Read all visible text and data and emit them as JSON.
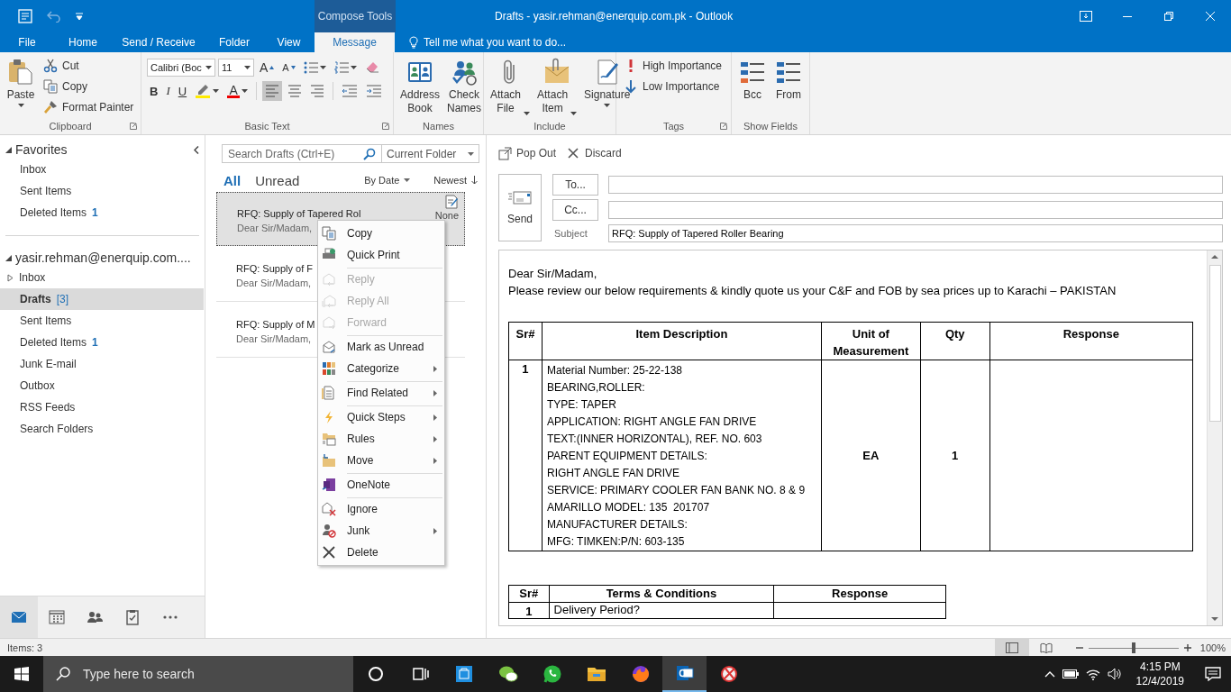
{
  "window": {
    "title": "Drafts - yasir.rehman@enerquip.com.pk - Outlook",
    "context_group": "Compose Tools"
  },
  "ribbon_tabs": [
    {
      "label": "File",
      "selected": false
    },
    {
      "label": "Home",
      "selected": false
    },
    {
      "label": "Send / Receive",
      "selected": false
    },
    {
      "label": "Folder",
      "selected": false
    },
    {
      "label": "View",
      "selected": false
    },
    {
      "label": "Message",
      "selected": true
    }
  ],
  "tell_me": {
    "placeholder": "Tell me what you want to do..."
  },
  "ribbon_groups": [
    {
      "label": "Clipboard",
      "kind": "buttons",
      "launcher": true,
      "buttons": [
        {
          "label": "Paste",
          "kind": "dropdown"
        },
        {
          "label": "Cut",
          "kind": "small"
        },
        {
          "label": "Copy",
          "kind": "small"
        },
        {
          "label": "Format Painter",
          "kind": "small"
        }
      ]
    },
    {
      "label": "Basic Text",
      "kind": "font",
      "launcher": true,
      "font": "Calibri (Boc",
      "size": "11",
      "size_buttons": [
        {
          "label": "A",
          "kind": "grow"
        },
        {
          "label": "A",
          "kind": "shrink"
        }
      ],
      "style_buttons": [
        "B",
        "I",
        "U"
      ],
      "font_color": "A",
      "align": [
        {
          "selected": true
        },
        {
          "selected": false
        },
        {
          "selected": false
        }
      ]
    },
    {
      "label": "Names",
      "kind": "buttons",
      "buttons": [
        {
          "label": "Address Book",
          "kind": "large"
        },
        {
          "label": "Check Names",
          "kind": "large"
        }
      ]
    },
    {
      "label": "Include",
      "kind": "buttons",
      "buttons": [
        {
          "label": "Attach File",
          "kind": "labelmenu"
        },
        {
          "label": "Attach Item",
          "kind": "labelmenu"
        },
        {
          "label": "Signature",
          "kind": "dropdown"
        }
      ]
    },
    {
      "label": "Tags",
      "kind": "buttons",
      "launcher": true,
      "buttons": [
        {
          "label": "High Importance",
          "kind": "small"
        },
        {
          "label": "Low Importance",
          "kind": "small"
        }
      ]
    },
    {
      "label": "Show Fields",
      "kind": "buttons",
      "buttons": [
        {
          "label": "Bcc",
          "kind": "large"
        },
        {
          "label": "From",
          "kind": "large"
        }
      ]
    }
  ],
  "navigation": {
    "sections": [
      {
        "header": "Favorites",
        "expanded": true,
        "folders": [
          {
            "name": "Inbox",
            "kind": "plain",
            "selected": false
          },
          {
            "name": "Sent Items",
            "kind": "plain",
            "selected": false
          },
          {
            "name": "Deleted Items",
            "kind": "plain",
            "count": "1",
            "selected": false
          }
        ]
      },
      {
        "header": "yasir.rehman@enerquip.com....",
        "expanded": true,
        "folders": [
          {
            "name": "Inbox",
            "kind": "expandable",
            "expanded": false,
            "selected": false
          },
          {
            "name": "Drafts",
            "kind": "plain",
            "count": "[3]",
            "selected": true
          },
          {
            "name": "Sent Items",
            "kind": "plain",
            "selected": false
          },
          {
            "name": "Deleted Items",
            "kind": "plain",
            "count": "1",
            "selected": false
          },
          {
            "name": "Junk E-mail",
            "kind": "plain",
            "selected": false
          },
          {
            "name": "Outbox",
            "kind": "plain",
            "selected": false
          },
          {
            "name": "RSS Feeds",
            "kind": "plain",
            "selected": false
          },
          {
            "name": "Search Folders",
            "kind": "plain",
            "selected": false
          }
        ]
      }
    ],
    "modules": [
      {
        "selected": true
      },
      {
        "selected": false
      },
      {
        "selected": false
      },
      {
        "selected": false
      },
      {
        "selected": false
      }
    ]
  },
  "message_list": {
    "search": {
      "placeholder": "Search Drafts (Ctrl+E)"
    },
    "scope": "Current Folder",
    "filters": [
      {
        "label": "All",
        "selected": true
      },
      {
        "label": "Unread",
        "selected": false
      }
    ],
    "sort": "By Date",
    "order": "Newest",
    "messages": [
      {
        "subject": "RFQ: Supply of Tapered Rol",
        "preview": "Dear Sir/Madam,",
        "category": "None",
        "selected": true
      },
      {
        "subject": "RFQ: Supply of F",
        "preview": "Dear Sir/Madam,",
        "selected": false
      },
      {
        "subject": "RFQ: Supply of M",
        "preview": "Dear Sir/Madam,",
        "selected": false
      }
    ]
  },
  "context_menu": [
    {
      "label": "Copy",
      "disabled": false,
      "submenu": false,
      "separator_after": false
    },
    {
      "label": "Quick Print",
      "disabled": false,
      "submenu": false,
      "separator_after": true
    },
    {
      "label": "Reply",
      "disabled": true,
      "submenu": false,
      "separator_after": false
    },
    {
      "label": "Reply All",
      "disabled": true,
      "submenu": false,
      "separator_after": false
    },
    {
      "label": "Forward",
      "disabled": true,
      "submenu": false,
      "separator_after": true
    },
    {
      "label": "Mark as Unread",
      "disabled": false,
      "submenu": false,
      "separator_after": false
    },
    {
      "label": "Categorize",
      "disabled": false,
      "submenu": true,
      "separator_after": true
    },
    {
      "label": "Find Related",
      "disabled": false,
      "submenu": true,
      "separator_after": true
    },
    {
      "label": "Quick Steps",
      "disabled": false,
      "submenu": true,
      "separator_after": false
    },
    {
      "label": "Rules",
      "disabled": false,
      "submenu": true,
      "separator_after": false
    },
    {
      "label": "Move",
      "disabled": false,
      "submenu": true,
      "separator_after": true
    },
    {
      "label": "OneNote",
      "disabled": false,
      "submenu": false,
      "separator_after": true
    },
    {
      "label": "Ignore",
      "disabled": false,
      "submenu": false,
      "separator_after": false
    },
    {
      "label": "Junk",
      "disabled": false,
      "submenu": true,
      "separator_after": false
    },
    {
      "label": "Delete",
      "disabled": false,
      "submenu": false,
      "separator_after": false
    }
  ],
  "reading_pane": {
    "commands": [
      "Pop Out",
      "Discard"
    ],
    "send": "Send",
    "to": "To...",
    "cc": "Cc...",
    "subject": {
      "label": "Subject",
      "value": "RFQ: Supply of Tapered Roller Bearing"
    },
    "body": {
      "greeting": "Dear Sir/Madam,",
      "intro": "Please review our below requirements & kindly quote us your C&F and FOB by sea prices up to Karachi – PAKISTAN",
      "items_table": {
        "columns": [
          "Sr#",
          "Item Description",
          "Unit of Measurement",
          "Qty",
          "Response"
        ],
        "rows": [
          {
            "sr": "1",
            "description": [
              "Material Number: 25-22-138",
              "BEARING,ROLLER:",
              "TYPE: TAPER",
              "APPLICATION: RIGHT ANGLE FAN DRIVE",
              "TEXT:(INNER HORIZONTAL), REF. NO. 603",
              "PARENT EQUIPMENT DETAILS:",
              "RIGHT ANGLE FAN DRIVE",
              "SERVICE: PRIMARY COOLER FAN BANK NO. 8 & 9",
              "AMARILLO MODEL: 135  201707",
              "MANUFACTURER DETAILS:",
              "MFG: TIMKEN:P/N: 603-135"
            ],
            "unit": "EA",
            "qty": "1"
          }
        ]
      },
      "terms_table": {
        "columns": [
          "Sr#",
          "Terms & Conditions",
          "Response"
        ],
        "rows": [
          {
            "sr": "1",
            "term": "Delivery Period?"
          }
        ]
      }
    }
  },
  "status_bar": {
    "items": "Items: 3",
    "views": [
      {
        "selected": true
      },
      {
        "selected": false
      }
    ],
    "zoom": {
      "level": 0.5,
      "reading": "100%"
    }
  },
  "taskbar": {
    "search": {
      "placeholder": "Type here to search"
    },
    "apps": [
      {
        "active": false
      },
      {
        "active": false
      },
      {
        "active": false
      },
      {
        "active": false
      },
      {
        "active": false
      },
      {
        "active": false
      },
      {
        "active": false
      },
      {
        "active": true
      },
      {
        "active": false
      }
    ],
    "time": "4:15 PM",
    "date": "12/4/2019"
  }
}
